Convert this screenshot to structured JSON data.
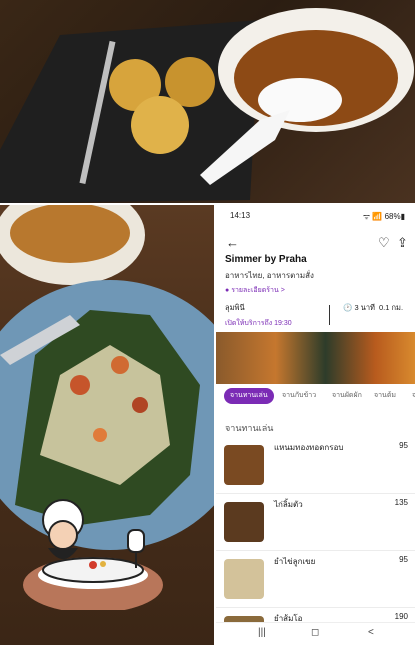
{
  "status": {
    "time": "14:13",
    "system": "ᯤ 📶 68%▮"
  },
  "header": {
    "back_icon": "arrow-left-icon",
    "favorite_icon": "heart-icon",
    "share_icon": "share-icon"
  },
  "restaurant": {
    "name": "Simmer by Praha",
    "cuisines": "อาหารไทย, อาหารตามสั่ง",
    "details_link": "รายละเอียดร้าน >",
    "hours_label": "ลุมพินี",
    "open_status": "เปิดให้บริการถึง 19:30",
    "duration": "3 นาที",
    "distance": "0.1 กม."
  },
  "tabs": [
    "จานทานเล่น",
    "จานกับข้าว",
    "จานผัดผัก",
    "จานต้ม",
    "จานผ"
  ],
  "active_tab": 0,
  "section_title": "จานทานเล่น",
  "menu": [
    {
      "name": "แหนมทองทอดกรอบ",
      "price": "95",
      "color": "#7a4a22"
    },
    {
      "name": "ไก่ลิ้มตัว",
      "price": "135",
      "color": "#5b3a1f"
    },
    {
      "name": "ยำไข่ลูกเขย",
      "price": "95",
      "color": "#d3c29a"
    },
    {
      "name": "ยำส้มโอ",
      "price": "190",
      "color": "#8a6a3b"
    }
  ],
  "nav": {
    "recent": "|||",
    "home": "◻",
    "back": "<"
  },
  "colors": {
    "accent": "#7b2bb5"
  }
}
